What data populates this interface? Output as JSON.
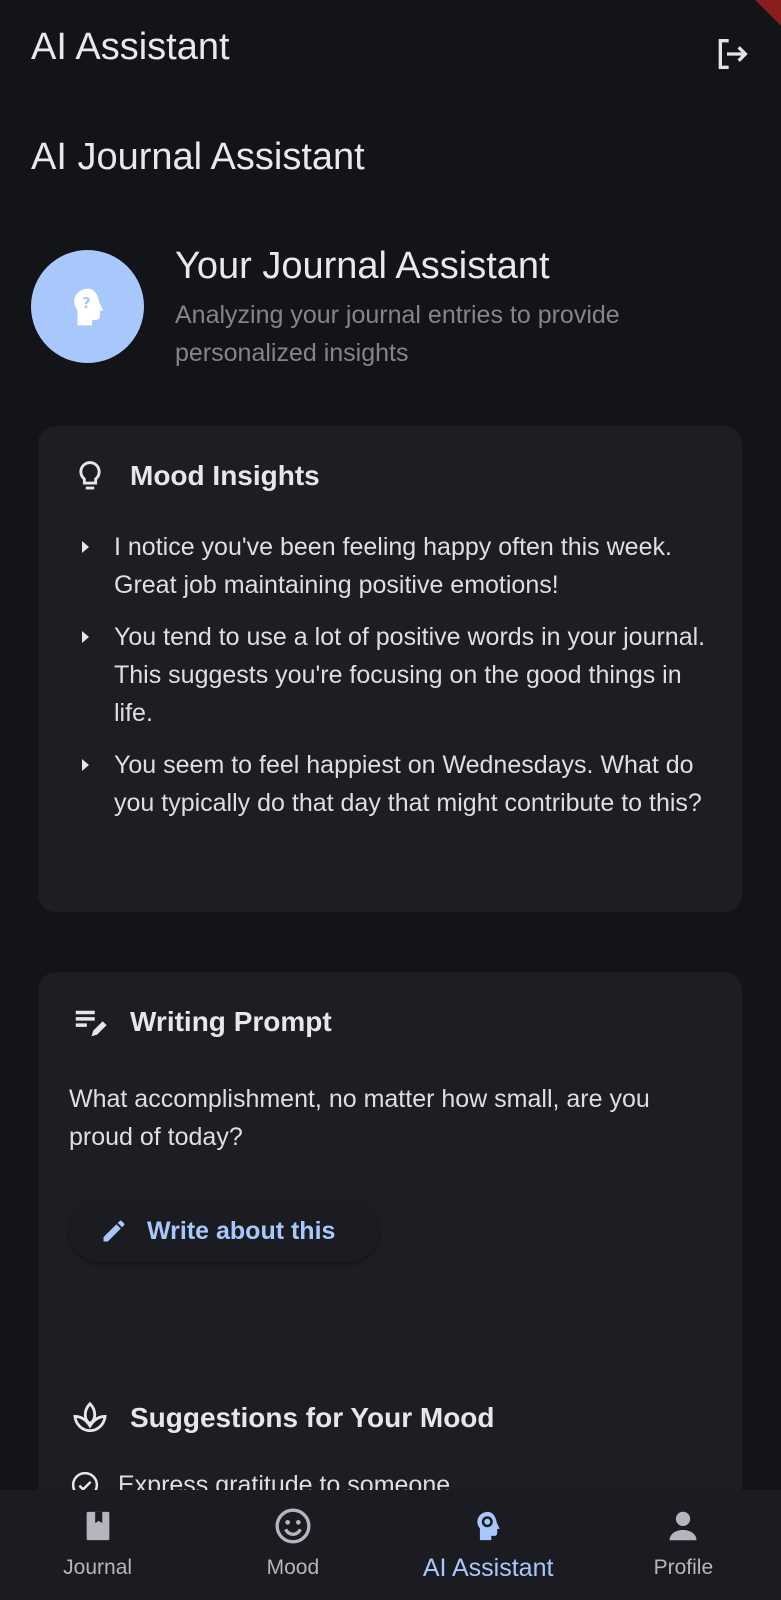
{
  "app_bar": {
    "title": "AI Assistant",
    "logout_icon": "logout-icon"
  },
  "page": {
    "title": "AI Journal Assistant"
  },
  "assistant": {
    "icon": "psychology-alt-icon",
    "title": "Your Journal Assistant",
    "subtitle": "Analyzing your journal entries to provide personalized insights"
  },
  "mood_insights": {
    "icon": "lightbulb-icon",
    "title": "Mood Insights",
    "items": [
      "I notice you've been feeling happy often this week. Great job maintaining positive emotions!",
      "You tend to use a lot of positive words in your journal. This suggests you're focusing on the good things in life.",
      "You seem to feel happiest on Wednesdays. What do you typically do that day that might contribute to this?"
    ]
  },
  "writing_prompt": {
    "icon": "edit-note-icon",
    "title": "Writing Prompt",
    "text": "What accomplishment, no matter how small, are you proud of today?",
    "button_label": "Write about this"
  },
  "suggestions": {
    "icon": "spa-icon",
    "title": "Suggestions for Your Mood",
    "items": [
      "Express gratitude to someone"
    ]
  },
  "nav": {
    "items": [
      {
        "label": "Journal",
        "icon": "book-icon",
        "active": false
      },
      {
        "label": "Mood",
        "icon": "mood-icon",
        "active": false
      },
      {
        "label": "AI Assistant",
        "icon": "psychology-icon",
        "active": true
      },
      {
        "label": "Profile",
        "icon": "person-icon",
        "active": false
      }
    ]
  },
  "colors": {
    "background": "#131418",
    "card": "#1d1e23",
    "accent": "#a8c8fb",
    "muted_text": "#84858c"
  }
}
